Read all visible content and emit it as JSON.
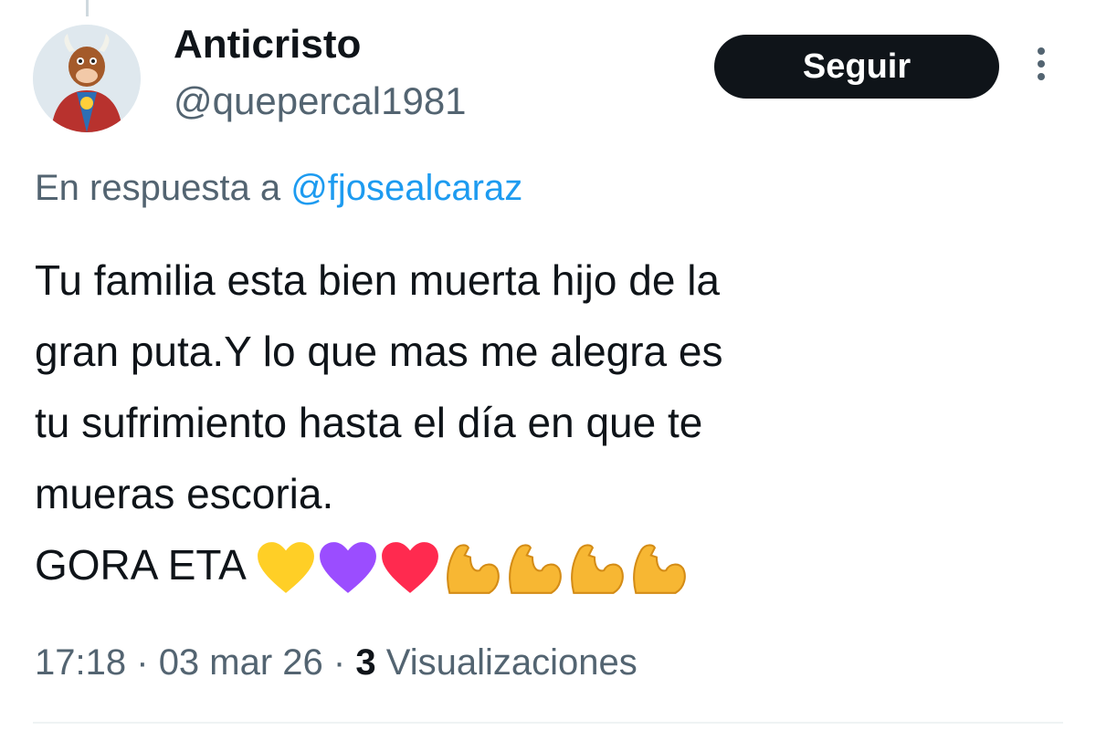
{
  "tweet": {
    "author_name": "Anticristo",
    "author_handle": "@quepercal1981",
    "follow_label": "Seguir",
    "reply_prefix": "En respuesta a",
    "reply_handle": "@fjosealcaraz",
    "text_lines": [
      "Tu familia esta bien muerta hijo de la",
      "gran puta.Y lo que mas me alegra es",
      "tu sufrimiento hasta el día en que te",
      "mueras escoria."
    ],
    "last_line_text": "GORA ETA",
    "emojis": [
      "yellow-heart-icon",
      "purple-heart-icon",
      "red-heart-icon",
      "flexed-biceps-icon",
      "flexed-biceps-icon",
      "flexed-biceps-icon",
      "flexed-biceps-icon"
    ],
    "time": "17:18",
    "date": "03 mar 26",
    "separator": "·",
    "views_count": "3",
    "views_label": "Visualizaciones"
  },
  "colors": {
    "text": "#0f1419",
    "secondary": "#536471",
    "link": "#1d9bf0",
    "button_bg": "#0f1419",
    "yellow_heart": "#ffcf26",
    "purple_heart": "#9b4dff",
    "red_heart": "#ff2a4f",
    "biceps": "#f7b733"
  }
}
